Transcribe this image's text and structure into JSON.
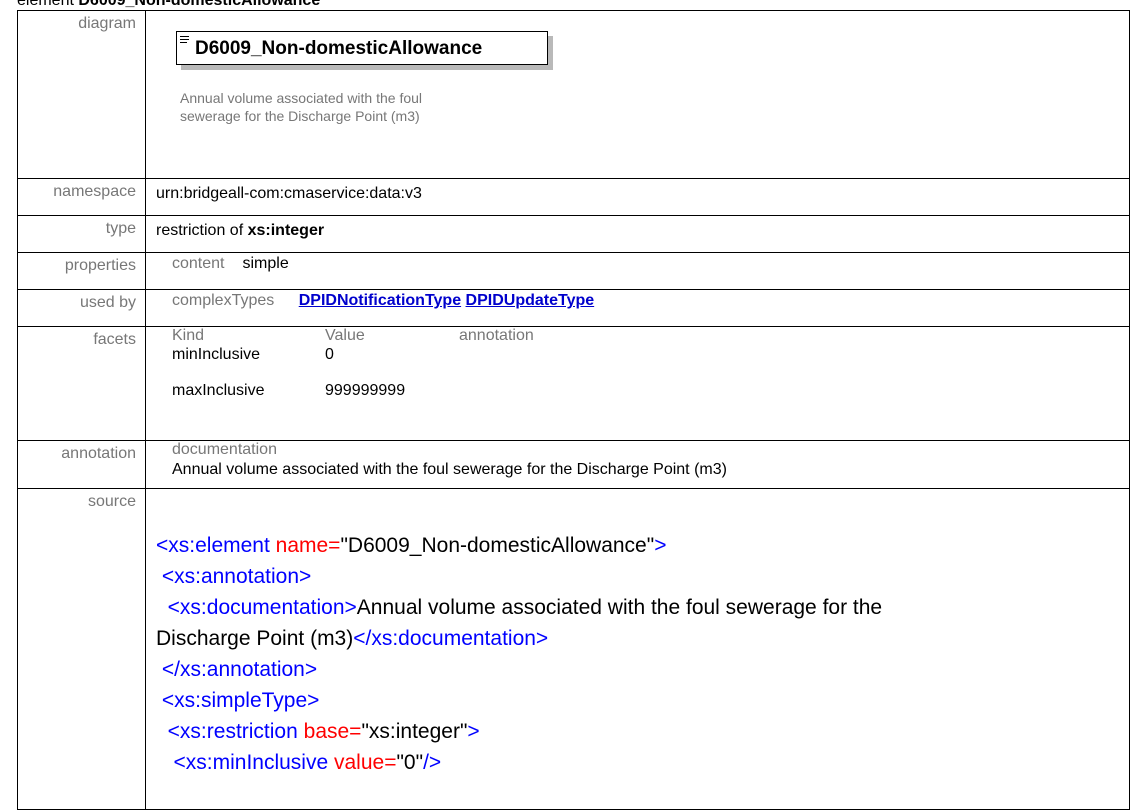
{
  "heading": {
    "prefix": "element ",
    "name": "D6009_Non-domesticAllowance"
  },
  "rows": {
    "diagram": {
      "label": "diagram",
      "element_name": "D6009_Non-domesticAllowance",
      "annotation_line1": "Annual volume associated with the foul",
      "annotation_line2": "sewerage for the Discharge Point (m3)"
    },
    "namespace": {
      "label": "namespace",
      "value": "urn:bridgeall-com:cmaservice:data:v3"
    },
    "type": {
      "label": "type",
      "prefix": "restriction of ",
      "base": "xs:integer"
    },
    "properties": {
      "label": "properties",
      "key": "content",
      "value": "simple"
    },
    "used_by": {
      "label": "used by",
      "key": "complexTypes",
      "links": [
        "DPIDNotificationType",
        "DPIDUpdateType"
      ]
    },
    "facets": {
      "label": "facets",
      "headers": [
        "Kind",
        "Value",
        "annotation"
      ],
      "rows": [
        {
          "kind": "minInclusive",
          "value": "0"
        },
        {
          "kind": "maxInclusive",
          "value": "999999999"
        }
      ]
    },
    "annotation": {
      "label": "annotation",
      "key": "documentation",
      "text": "Annual volume associated with the foul sewerage for the Discharge Point (m3)"
    },
    "source": {
      "label": "source",
      "lines": [
        {
          "tag_open": "<xs:element ",
          "attr": "name=",
          "val": "\"D6009_Non-domesticAllowance\"",
          "tag_close": ">"
        },
        {
          "tag": " <xs:annotation>"
        },
        {
          "tag": "  <xs:documentation>",
          "text": "Annual volume associated with the foul sewerage for the"
        },
        {
          "text": "Discharge Point (m3)",
          "tag": "</xs:documentation>"
        },
        {
          "tag": " </xs:annotation>"
        },
        {
          "tag": " <xs:simpleType>"
        },
        {
          "tag_open": "  <xs:restriction ",
          "attr": "base=",
          "val": "\"xs:integer\"",
          "tag_close": ">"
        },
        {
          "tag_open": "   <xs:minInclusive ",
          "attr": "value=",
          "val": "\"0\"",
          "tag_close": "/>"
        }
      ]
    }
  }
}
